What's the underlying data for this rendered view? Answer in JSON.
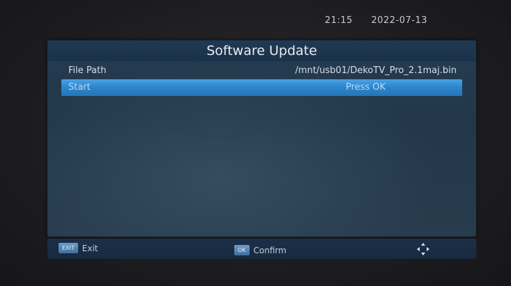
{
  "status": {
    "time": "21:15",
    "date": "2022-07-13"
  },
  "dialog": {
    "title": "Software Update",
    "file_path": {
      "label": "File Path",
      "value": "/mnt/usb01/DekoTV_Pro_2.1maj.bin"
    },
    "start": {
      "label": "Start",
      "value": "Press OK"
    }
  },
  "footer": {
    "exit_key": "EXIT",
    "exit_label": "Exit",
    "ok_key": "OK",
    "confirm_label": "Confirm",
    "nav_icon": "direction-pad-icon"
  },
  "colors": {
    "selected_row": "#2f86cc",
    "panel_bg": "#22384a",
    "footer_bg": "#1b2f47"
  }
}
